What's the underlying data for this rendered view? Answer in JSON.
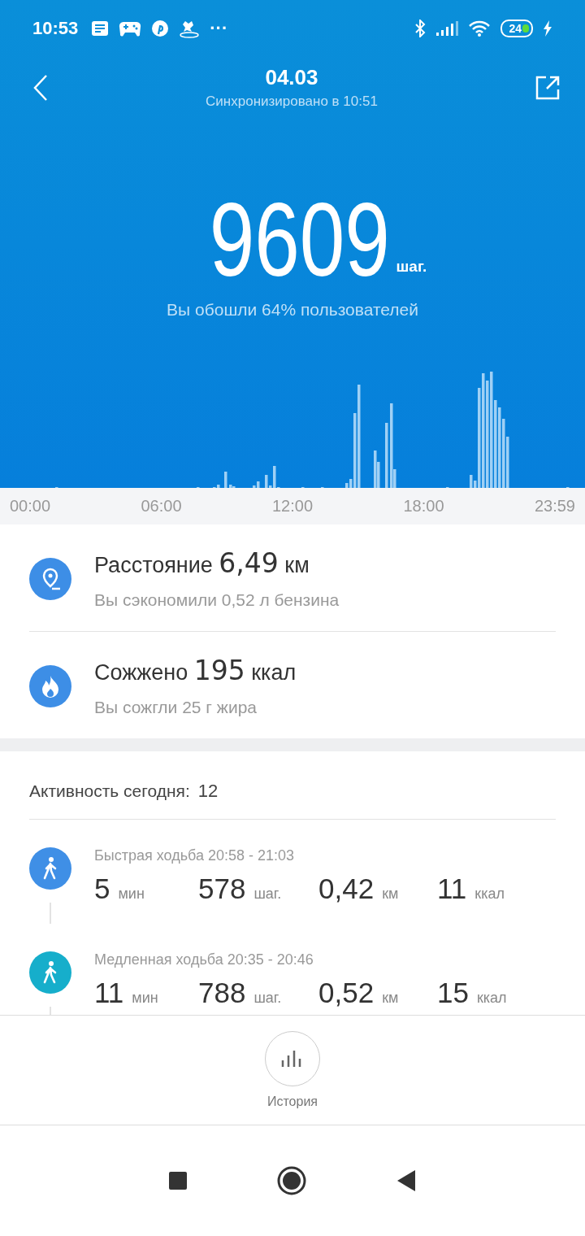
{
  "status_bar": {
    "time": "10:53",
    "more": "···",
    "battery": "24"
  },
  "header": {
    "title": "04.03",
    "subtitle": "Синхронизировано в 10:51"
  },
  "steps": {
    "value": "9609",
    "unit": "шаг.",
    "comparison": "Вы обошли 64% пользователей"
  },
  "chart_axis": [
    "00:00",
    "06:00",
    "12:00",
    "18:00",
    "23:59"
  ],
  "stats": [
    {
      "kind": "distance",
      "title": "Расстояние **6,49** км",
      "note": "Вы сэкономили 0,52 л бензина"
    },
    {
      "kind": "calories",
      "title": "Сожжено **195** ккал",
      "note": "Вы сожгли 25 г жира"
    }
  ],
  "activity": {
    "label": "Активность сегодня:",
    "count": "12",
    "items": [
      {
        "title": "Быстрая ходьба 20:58 - 21:03",
        "color": "#3f8fe6",
        "metrics": [
          {
            "value": "5",
            "unit": "мин"
          },
          {
            "value": "578",
            "unit": "шаг."
          },
          {
            "value": "0,42",
            "unit": "км"
          },
          {
            "value": "11",
            "unit": "ккал"
          }
        ]
      },
      {
        "title": "Медленная ходьба 20:35 - 20:46",
        "color": "#16aecb",
        "metrics": [
          {
            "value": "11",
            "unit": "мин"
          },
          {
            "value": "788",
            "unit": "шаг."
          },
          {
            "value": "0,52",
            "unit": "км"
          },
          {
            "value": "15",
            "unit": "ккал"
          }
        ]
      }
    ]
  },
  "history_button": {
    "label": "История"
  }
}
